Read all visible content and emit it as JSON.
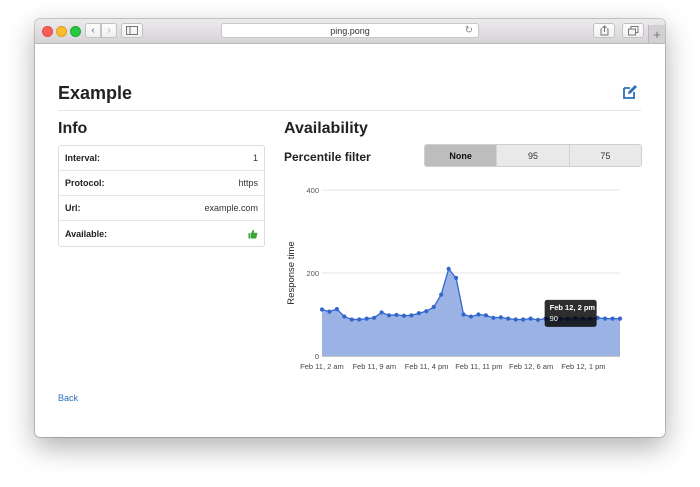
{
  "browser": {
    "url": "ping.pong"
  },
  "page": {
    "title": "Example",
    "back_label": "Back"
  },
  "info": {
    "heading": "Info",
    "rows": [
      {
        "key": "Interval:",
        "value": "1"
      },
      {
        "key": "Protocol:",
        "value": "https"
      },
      {
        "key": "Url:",
        "value": "example.com"
      },
      {
        "key": "Available:",
        "value_icon": "thumbs-up-icon"
      }
    ]
  },
  "availability": {
    "heading": "Availability",
    "filter_label": "Percentile filter",
    "filter_options": [
      "None",
      "95",
      "75"
    ],
    "active_filter": "None"
  },
  "colors": {
    "accent": "#2a6fb8",
    "series_line": "#3366cc",
    "series_fill": "#9bb3e4",
    "available": "#3aa63a"
  },
  "chart_data": {
    "type": "area",
    "ylabel": "Response time",
    "ylim": [
      0,
      400
    ],
    "yticks": [
      0,
      200,
      400
    ],
    "grid": true,
    "x_tick_labels": [
      "Feb 11, 2 am",
      "Feb 11, 9 am",
      "Feb 11, 4 pm",
      "Feb 11, 11 pm",
      "Feb 12, 6 am",
      "Feb 12, 1 pm"
    ],
    "series": [
      {
        "values": [
          112,
          107,
          113,
          95,
          88,
          88,
          90,
          92,
          105,
          98,
          99,
          97,
          98,
          103,
          108,
          118,
          148,
          210,
          188,
          100,
          95,
          100,
          98,
          92,
          93,
          90,
          88,
          88,
          90,
          87,
          90,
          90,
          89,
          90,
          91,
          90,
          90,
          92,
          90,
          90,
          90
        ]
      }
    ],
    "tooltip": {
      "title": "Feb 12, 2 pm",
      "value": "90",
      "index": 37
    }
  }
}
